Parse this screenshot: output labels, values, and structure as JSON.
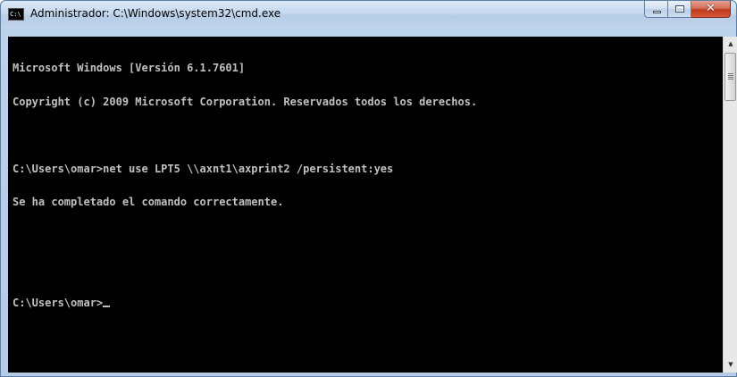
{
  "window": {
    "title": "Administrador: C:\\Windows\\system32\\cmd.exe",
    "icon": "cmd-icon",
    "icon_text": "C:\\",
    "close_glyph": "✕"
  },
  "console": {
    "lines": [
      "Microsoft Windows [Versión 6.1.7601]",
      "Copyright (c) 2009 Microsoft Corporation. Reservados todos los derechos.",
      "",
      "C:\\Users\\omar>net use LPT5 \\\\axnt1\\axprint2 /persistent:yes",
      "Se ha completado el comando correctamente.",
      "",
      ""
    ],
    "prompt": "C:\\Users\\omar>"
  },
  "scrollbar": {
    "up_arrow": "▲",
    "down_arrow": "▼"
  },
  "colors": {
    "console_bg": "#000000",
    "console_fg": "#c0c0c0",
    "close_button": "#c8432a"
  }
}
